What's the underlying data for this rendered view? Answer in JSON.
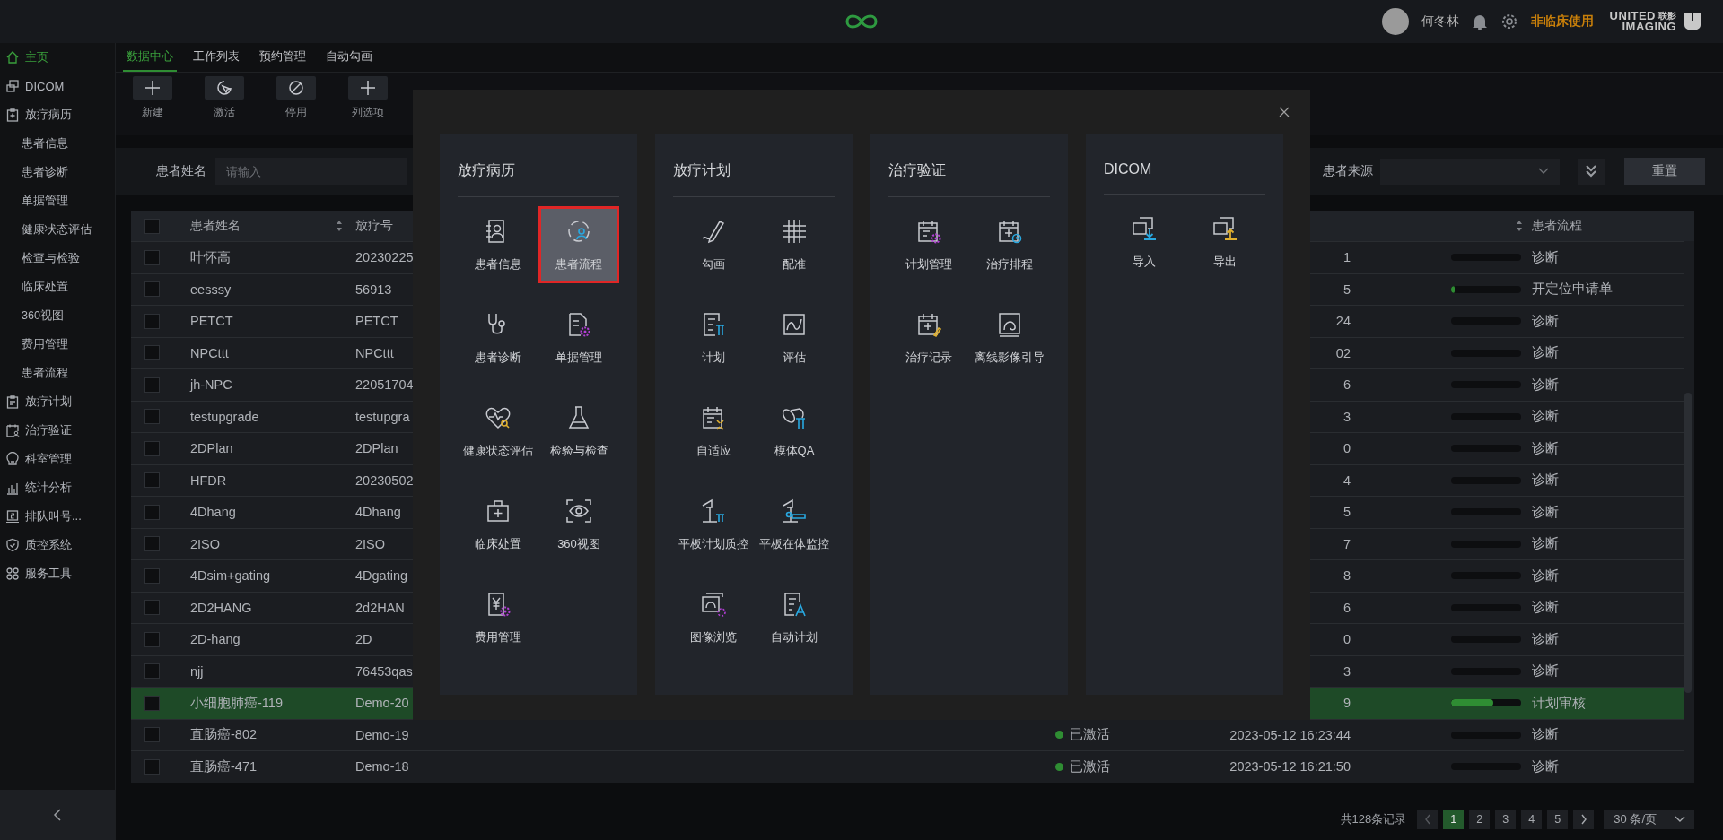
{
  "topbar": {
    "user": "何冬林",
    "mode": "非临床使用",
    "logo": [
      "UNITED",
      "联影",
      "IMAGING"
    ]
  },
  "sidebar": {
    "items": [
      {
        "label": "主页",
        "selected": true
      },
      {
        "label": "DICOM",
        "selected": false
      },
      {
        "label": "放疗病历",
        "selected": false,
        "children": [
          {
            "label": "患者信息",
            "selected": false
          },
          {
            "label": "患者诊断",
            "selected": false
          },
          {
            "label": "单据管理",
            "selected": false
          },
          {
            "label": "健康状态评估",
            "selected": false
          },
          {
            "label": "检查与检验",
            "selected": false
          },
          {
            "label": "临床处置",
            "selected": false
          },
          {
            "label": "360视图",
            "selected": false
          },
          {
            "label": "费用管理",
            "selected": false
          },
          {
            "label": "患者流程",
            "selected": false
          }
        ]
      },
      {
        "label": "放疗计划",
        "selected": false
      },
      {
        "label": "治疗验证",
        "selected": false
      },
      {
        "label": "科室管理",
        "selected": false
      },
      {
        "label": "统计分析",
        "selected": false
      },
      {
        "label": "排队叫号...",
        "selected": false
      },
      {
        "label": "质控系统",
        "selected": false
      },
      {
        "label": "服务工具",
        "selected": false
      }
    ]
  },
  "tabs": [
    {
      "label": "数据中心",
      "selected": true
    },
    {
      "label": "工作列表",
      "selected": false
    },
    {
      "label": "预约管理",
      "selected": false
    },
    {
      "label": "自动勾画",
      "selected": false
    }
  ],
  "toolbar": [
    "新建",
    "激活",
    "停用",
    "列选项"
  ],
  "filters": {
    "name_label": "患者姓名",
    "name_placeholder": "请输入",
    "source_label": "患者来源",
    "reset": "重置"
  },
  "table": {
    "header_checked": false,
    "columns": [
      "患者姓名",
      "放疗号",
      "患者流程"
    ],
    "rows": [
      {
        "name": "叶怀高",
        "number": "20230225",
        "time": "1",
        "level": 0,
        "stage": "诊断",
        "checked": false,
        "selected": false
      },
      {
        "name": "eesssy",
        "number": "56913",
        "time": "5",
        "level": 0.05,
        "stage": "开定位申请单",
        "checked": false,
        "selected": false
      },
      {
        "name": "PETCT",
        "number": "PETCT",
        "time": "24",
        "level": 0,
        "stage": "诊断",
        "checked": false,
        "selected": false
      },
      {
        "name": "NPCttt",
        "number": "NPCttt",
        "time": "02",
        "level": 0,
        "stage": "诊断",
        "checked": false,
        "selected": false
      },
      {
        "name": "jh-NPC",
        "number": "22051704",
        "time": "6",
        "level": 0,
        "stage": "诊断",
        "checked": false,
        "selected": false
      },
      {
        "name": "testupgrade",
        "number": "testupgra",
        "time": "3",
        "level": 0,
        "stage": "诊断",
        "checked": false,
        "selected": false
      },
      {
        "name": "2DPlan",
        "number": "2DPlan",
        "time": "0",
        "level": 0,
        "stage": "诊断",
        "checked": false,
        "selected": false
      },
      {
        "name": "HFDR",
        "number": "20230502",
        "time": "4",
        "level": 0,
        "stage": "诊断",
        "checked": false,
        "selected": false
      },
      {
        "name": "4Dhang",
        "number": "4Dhang",
        "time": "5",
        "level": 0,
        "stage": "诊断",
        "checked": false,
        "selected": false
      },
      {
        "name": "2ISO",
        "number": "2ISO",
        "time": "7",
        "level": 0,
        "stage": "诊断",
        "checked": false,
        "selected": false
      },
      {
        "name": "4Dsim+gating",
        "number": "4Dgating",
        "time": "8",
        "level": 0,
        "stage": "诊断",
        "checked": false,
        "selected": false
      },
      {
        "name": "2D2HANG",
        "number": "2d2HAN",
        "time": "6",
        "level": 0,
        "stage": "诊断",
        "checked": false,
        "selected": false
      },
      {
        "name": "2D-hang",
        "number": "2D",
        "time": "0",
        "level": 0,
        "stage": "诊断",
        "checked": false,
        "selected": false
      },
      {
        "name": "njj",
        "number": "76453qas",
        "time": "3",
        "level": 0,
        "stage": "诊断",
        "checked": false,
        "selected": false
      },
      {
        "name": "小细胞肺癌-119",
        "number": "Demo-20",
        "time": "9",
        "level": 0.6,
        "stage": "计划审核",
        "checked": false,
        "selected": true
      },
      {
        "name": "直肠癌-802",
        "number": "Demo-19",
        "status": "已激活",
        "time": "2023-05-12 16:23:44",
        "level": 0,
        "stage": "诊断",
        "checked": false,
        "selected": false
      },
      {
        "name": "直肠癌-471",
        "number": "Demo-18",
        "status": "已激活",
        "time": "2023-05-12 16:21:50",
        "level": 0,
        "stage": "诊断",
        "checked": false,
        "selected": false
      }
    ]
  },
  "pagination": {
    "total": "共128条记录",
    "pages": [
      {
        "label": "1",
        "selected": true
      },
      {
        "label": "2",
        "selected": false
      },
      {
        "label": "3",
        "selected": false
      },
      {
        "label": "4",
        "selected": false
      },
      {
        "label": "5",
        "selected": false
      }
    ],
    "page_size": "30 条/页"
  },
  "modal": {
    "groups": [
      {
        "title": "放疗病历",
        "items": [
          {
            "label": "患者信息",
            "selected": false
          },
          {
            "label": "患者流程",
            "selected": true
          },
          {
            "label": "患者诊断",
            "selected": false
          },
          {
            "label": "单据管理",
            "selected": false
          },
          {
            "label": "健康状态评估",
            "selected": false
          },
          {
            "label": "检验与检查",
            "selected": false
          },
          {
            "label": "临床处置",
            "selected": false
          },
          {
            "label": "360视图",
            "selected": false
          },
          {
            "label": "费用管理",
            "selected": false
          }
        ]
      },
      {
        "title": "放疗计划",
        "items": [
          {
            "label": "勾画",
            "selected": false
          },
          {
            "label": "配准",
            "selected": false
          },
          {
            "label": "计划",
            "selected": false
          },
          {
            "label": "评估",
            "selected": false
          },
          {
            "label": "自适应",
            "selected": false
          },
          {
            "label": "模体QA",
            "selected": false
          },
          {
            "label": "平板计划质控",
            "selected": false
          },
          {
            "label": "平板在体监控",
            "selected": false
          },
          {
            "label": "图像浏览",
            "selected": false
          },
          {
            "label": "自动计划",
            "selected": false
          }
        ]
      },
      {
        "title": "治疗验证",
        "items": [
          {
            "label": "计划管理",
            "selected": false
          },
          {
            "label": "治疗排程",
            "selected": false
          },
          {
            "label": "治疗记录",
            "selected": false
          },
          {
            "label": "离线影像引导",
            "selected": false
          }
        ]
      },
      {
        "title": "DICOM",
        "items": [
          {
            "label": "导入",
            "selected": false
          },
          {
            "label": "导出",
            "selected": false
          }
        ]
      }
    ]
  }
}
